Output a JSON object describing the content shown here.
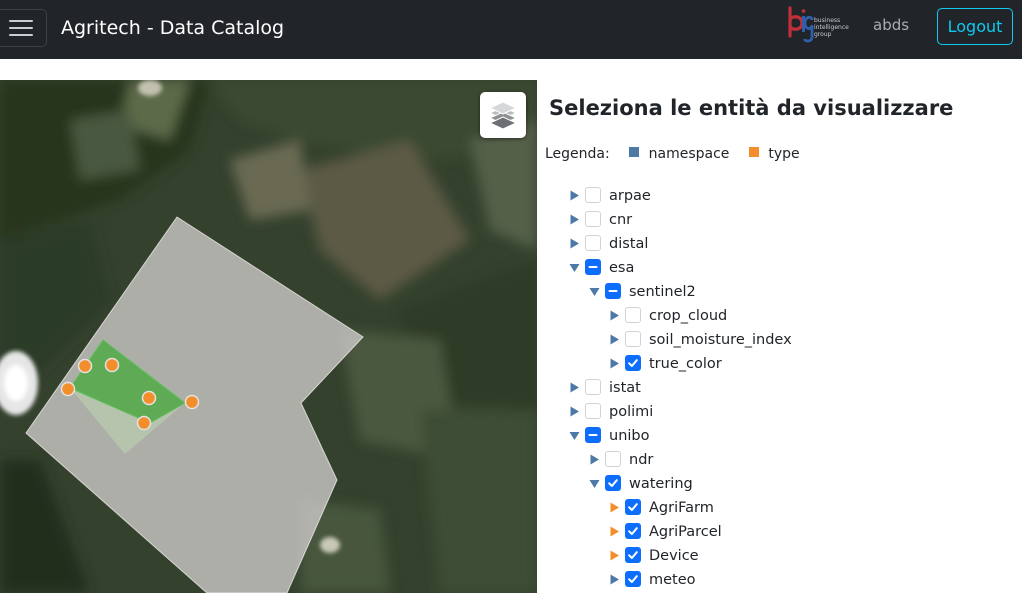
{
  "header": {
    "title": "Agritech - Data Catalog",
    "logo_text": [
      "business",
      "intelligence",
      "group"
    ],
    "username": "abds",
    "logout_label": "Logout"
  },
  "map": {
    "layers_icon": "layers-icon"
  },
  "panel": {
    "title": "Seleziona le entità da visualizzare",
    "legend": {
      "label": "Legenda:",
      "items": [
        {
          "name": "namespace",
          "color": "#4e79a7"
        },
        {
          "name": "type",
          "color": "#f28e2b"
        }
      ]
    },
    "tree": [
      {
        "label": "arpae",
        "state": "unchecked",
        "expanded": false,
        "level": 0,
        "kind": "namespace"
      },
      {
        "label": "cnr",
        "state": "unchecked",
        "expanded": false,
        "level": 0,
        "kind": "namespace"
      },
      {
        "label": "distal",
        "state": "unchecked",
        "expanded": false,
        "level": 0,
        "kind": "namespace"
      },
      {
        "label": "esa",
        "state": "partial",
        "expanded": true,
        "level": 0,
        "kind": "namespace"
      },
      {
        "label": "sentinel2",
        "state": "partial",
        "expanded": true,
        "level": 1,
        "kind": "namespace"
      },
      {
        "label": "crop_cloud",
        "state": "unchecked",
        "expanded": false,
        "level": 2,
        "kind": "namespace"
      },
      {
        "label": "soil_moisture_index",
        "state": "unchecked",
        "expanded": false,
        "level": 2,
        "kind": "namespace"
      },
      {
        "label": "true_color",
        "state": "checked",
        "expanded": false,
        "level": 2,
        "kind": "namespace"
      },
      {
        "label": "istat",
        "state": "unchecked",
        "expanded": false,
        "level": 0,
        "kind": "namespace"
      },
      {
        "label": "polimi",
        "state": "unchecked",
        "expanded": false,
        "level": 0,
        "kind": "namespace"
      },
      {
        "label": "unibo",
        "state": "partial",
        "expanded": true,
        "level": 0,
        "kind": "namespace"
      },
      {
        "label": "ndr",
        "state": "unchecked",
        "expanded": false,
        "level": 1,
        "kind": "namespace"
      },
      {
        "label": "watering",
        "state": "checked",
        "expanded": true,
        "level": 1,
        "kind": "namespace"
      },
      {
        "label": "AgriFarm",
        "state": "checked",
        "expanded": false,
        "level": 2,
        "kind": "type"
      },
      {
        "label": "AgriParcel",
        "state": "checked",
        "expanded": false,
        "level": 2,
        "kind": "type"
      },
      {
        "label": "Device",
        "state": "checked",
        "expanded": false,
        "level": 2,
        "kind": "type"
      },
      {
        "label": "meteo",
        "state": "checked",
        "expanded": false,
        "level": 2,
        "kind": "namespace"
      }
    ]
  }
}
